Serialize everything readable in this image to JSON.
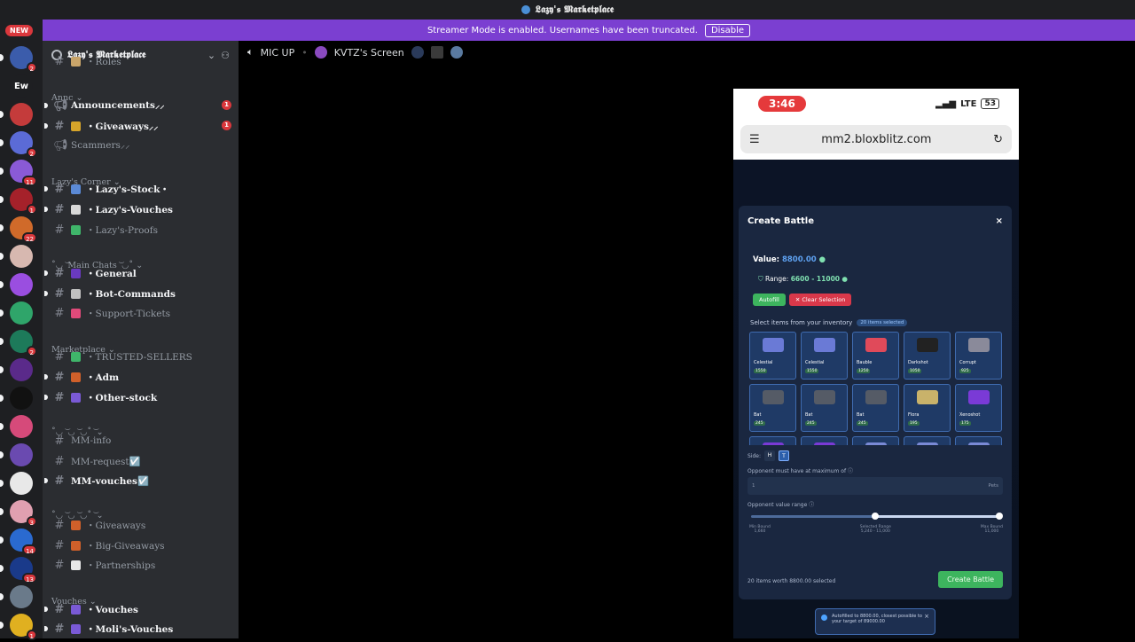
{
  "window": {
    "title": "𝕷𝖆𝖟𝖞'𝖘 𝕸𝖆𝖗𝖐𝖊𝖙𝖕𝖑𝖆𝖈𝖊"
  },
  "banner": {
    "message": "Streamer Mode is enabled. Usernames have been truncated.",
    "button": "Disable"
  },
  "rail": {
    "new_badge": "NEW",
    "servers": [
      {
        "label": "",
        "color": "#3b5cab",
        "mention": "2"
      },
      {
        "label": "Ew",
        "color": "#1e1f22",
        "mention": ""
      },
      {
        "label": "",
        "color": "#c43b3b",
        "mention": ""
      },
      {
        "label": "",
        "color": "#5b6bd6",
        "mention": "2"
      },
      {
        "label": "",
        "color": "#8a5ad6",
        "mention": "11"
      },
      {
        "label": "",
        "color": "#a5212a",
        "mention": "1"
      },
      {
        "label": "",
        "color": "#d06a2a",
        "mention": "22"
      },
      {
        "label": "",
        "color": "#d7b8b0",
        "mention": ""
      },
      {
        "label": "",
        "color": "#9a4ee0",
        "mention": ""
      },
      {
        "label": "",
        "color": "#2fa56a",
        "mention": ""
      },
      {
        "label": "",
        "color": "#1d7a5a",
        "mention": "2"
      },
      {
        "label": "",
        "color": "#5a2a8a",
        "mention": ""
      },
      {
        "label": "",
        "color": "#111111",
        "mention": ""
      },
      {
        "label": "",
        "color": "#d64a7a",
        "mention": ""
      },
      {
        "label": "",
        "color": "#6a4ab0",
        "mention": ""
      },
      {
        "label": "",
        "color": "#e8e8e8",
        "mention": ""
      },
      {
        "label": "",
        "color": "#e0a0b0",
        "mention": "3"
      },
      {
        "label": "",
        "color": "#2a6ad0",
        "mention": "14"
      },
      {
        "label": "",
        "color": "#1a3a8a",
        "mention": "13"
      },
      {
        "label": "",
        "color": "#6a7a8a",
        "mention": ""
      },
      {
        "label": "",
        "color": "#e0b020",
        "mention": "1"
      }
    ]
  },
  "guild": {
    "name": "𝕷𝖆𝖟𝖞'𝖘 𝕸𝖆𝖗𝖐𝖊𝖙𝖕𝖑𝖆𝖈𝖊"
  },
  "categories": [
    {
      "label": "Annc"
    },
    {
      "label": "Lazy's Corner"
    },
    {
      "label": "˚◡ ͝ Main Chats ͝ ◡˚"
    },
    {
      "label": "Marketplace"
    },
    {
      "label": "˚◡ ͝ ◡ ͝ ◡˚ ͝"
    },
    {
      "label": "˚◡ ͝ ◡ ͝ ◡˚ ͝"
    },
    {
      "label": "Vouches"
    }
  ],
  "channels": [
    {
      "name": "・Roles",
      "icon": "hash",
      "emoji": "#c9a56a",
      "unread": false,
      "badge": ""
    },
    {
      "name": "Announcements⸝⸝",
      "icon": "megaphone",
      "emoji": "",
      "unread": true,
      "badge": "1"
    },
    {
      "name": "・Giveaways⸝⸝",
      "icon": "hash",
      "emoji": "#d7a52a",
      "unread": true,
      "badge": "1"
    },
    {
      "name": "Scammers⸝⸝",
      "icon": "megaphone",
      "emoji": "",
      "unread": false,
      "badge": ""
    },
    {
      "name": "・Lazy's-Stock・",
      "icon": "hash",
      "emoji": "#5b8ad6",
      "unread": true,
      "badge": ""
    },
    {
      "name": "・Lazy's-Vouches",
      "icon": "hash",
      "emoji": "#d8d8d8",
      "unread": true,
      "badge": ""
    },
    {
      "name": "・Lazy's-Proofs",
      "icon": "hash",
      "emoji": "#3fb56a",
      "unread": false,
      "badge": ""
    },
    {
      "name": "・General",
      "icon": "hash",
      "emoji": "#6a3ac0",
      "unread": true,
      "badge": ""
    },
    {
      "name": "・Bot-Commands",
      "icon": "hash",
      "emoji": "#c0c0c0",
      "unread": true,
      "badge": ""
    },
    {
      "name": "・Support-Tickets",
      "icon": "hash",
      "emoji": "#e04a7a",
      "unread": false,
      "badge": ""
    },
    {
      "name": "・TRUSTED-SELLERS",
      "icon": "hash",
      "emoji": "#3fb56a",
      "unread": false,
      "badge": ""
    },
    {
      "name": "・Adm",
      "icon": "hash",
      "emoji": "#d0602a",
      "unread": true,
      "badge": ""
    },
    {
      "name": "・Other-stock",
      "icon": "hash",
      "emoji": "#7a5ad6",
      "unread": true,
      "badge": ""
    },
    {
      "name": "MM-info",
      "icon": "hash",
      "emoji": "",
      "unread": false,
      "badge": ""
    },
    {
      "name": "MM-request☑️",
      "icon": "hash",
      "emoji": "",
      "unread": false,
      "badge": ""
    },
    {
      "name": "MM-vouches☑️",
      "icon": "hash",
      "emoji": "",
      "unread": true,
      "badge": ""
    },
    {
      "name": "・Giveaways",
      "icon": "hash",
      "emoji": "#d0602a",
      "unread": false,
      "badge": ""
    },
    {
      "name": "・Big-Giveaways",
      "icon": "hash",
      "emoji": "#d0602a",
      "unread": false,
      "badge": ""
    },
    {
      "name": "・Partnerships",
      "icon": "hash",
      "emoji": "#e8e8e8",
      "unread": false,
      "badge": ""
    },
    {
      "name": "・Vouches",
      "icon": "hash",
      "emoji": "#7a5ad6",
      "unread": true,
      "badge": ""
    },
    {
      "name": "・Moli's-Vouches",
      "icon": "hash",
      "emoji": "#7a5ad6",
      "unread": true,
      "badge": ""
    }
  ],
  "stage": {
    "mic": "MIC UP",
    "screen": "KVTZ's Screen"
  },
  "phone": {
    "time": "3:46",
    "network": "LTE",
    "battery": "53",
    "url": "mm2.bloxblitz.com"
  },
  "modal": {
    "title": "Create Battle",
    "value_label": "Value:",
    "value": "8800.00",
    "range_label": "Range:",
    "range": "6600 - 11000",
    "autofill": "Autofill",
    "clear": "✕ Clear Selection",
    "select_label": "Select items from your inventory",
    "selected_pill": "20 items selected",
    "items": [
      {
        "name": "Celestial",
        "price": "1550",
        "color": "#6a7ad6"
      },
      {
        "name": "Celestial",
        "price": "1550",
        "color": "#6a7ad6"
      },
      {
        "name": "Bauble",
        "price": "1250",
        "color": "#e04a5a"
      },
      {
        "name": "Darkshot",
        "price": "1050",
        "color": "#222222"
      },
      {
        "name": "Corrupt",
        "price": "925",
        "color": "#8a8a9a"
      },
      {
        "name": "Bat",
        "price": "245",
        "color": "#555b66"
      },
      {
        "name": "Bat",
        "price": "245",
        "color": "#555b66"
      },
      {
        "name": "Bat",
        "price": "245",
        "color": "#555b66"
      },
      {
        "name": "Flora",
        "price": "195",
        "color": "#c9b26a"
      },
      {
        "name": "Xenoshot",
        "price": "175",
        "color": "#7a3ad6"
      },
      {
        "name": "",
        "price": "",
        "color": "#7a3ad6"
      },
      {
        "name": "",
        "price": "",
        "color": "#7a3ad6"
      },
      {
        "name": "",
        "price": "",
        "color": "#7a8ad6"
      },
      {
        "name": "",
        "price": "",
        "color": "#7a8ad6"
      },
      {
        "name": "",
        "price": "",
        "color": "#7a8ad6"
      }
    ],
    "side_label": "Side:",
    "side_h": "H",
    "side_t": "T",
    "opponent_max_label": "Opponent must have at maximum of",
    "opponent_max_value": "1",
    "opponent_max_unit": "Pets",
    "value_range_label": "Opponent value range",
    "min_bound_label": "Min Bound",
    "min_bound": "1,660",
    "selected_range_label": "Selected Range",
    "selected_range": "5,240 - 11,000",
    "max_bound_label": "Max Bound",
    "max_bound": "11,000",
    "slider_low": 0.5,
    "slider_high": 1.0,
    "footer": "20 items worth 8800.00 selected",
    "create": "Create Battle"
  },
  "toast": {
    "text": "Autofilled to 8800.00, closest possible to your target of 89000.00"
  }
}
